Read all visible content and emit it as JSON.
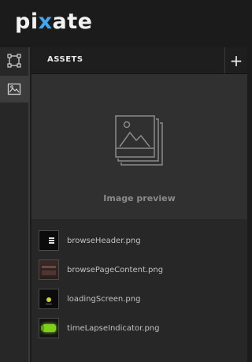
{
  "app": {
    "logo_prefix": "pi",
    "logo_x": "x",
    "logo_suffix": "ate"
  },
  "sidebar": {
    "items": [
      {
        "icon": "frame-icon",
        "active": false
      },
      {
        "icon": "image-icon",
        "active": true
      }
    ]
  },
  "panel": {
    "title": "ASSETS",
    "add_label": "+"
  },
  "preview": {
    "label": "Image preview"
  },
  "assets": [
    {
      "name": "browseHeader.png",
      "thumb": "browse-header-thumbnail"
    },
    {
      "name": "browsePageContent.png",
      "thumb": "browse-page-content-thumbnail"
    },
    {
      "name": "loadingScreen.png",
      "thumb": "loading-screen-thumbnail"
    },
    {
      "name": "timeLapseIndicator.png",
      "thumb": "time-lapse-indicator-thumbnail"
    }
  ],
  "colors": {
    "accent": "#3fa9f5",
    "background": "#1b1b1b",
    "panel": "#272727",
    "preview": "#303030"
  }
}
